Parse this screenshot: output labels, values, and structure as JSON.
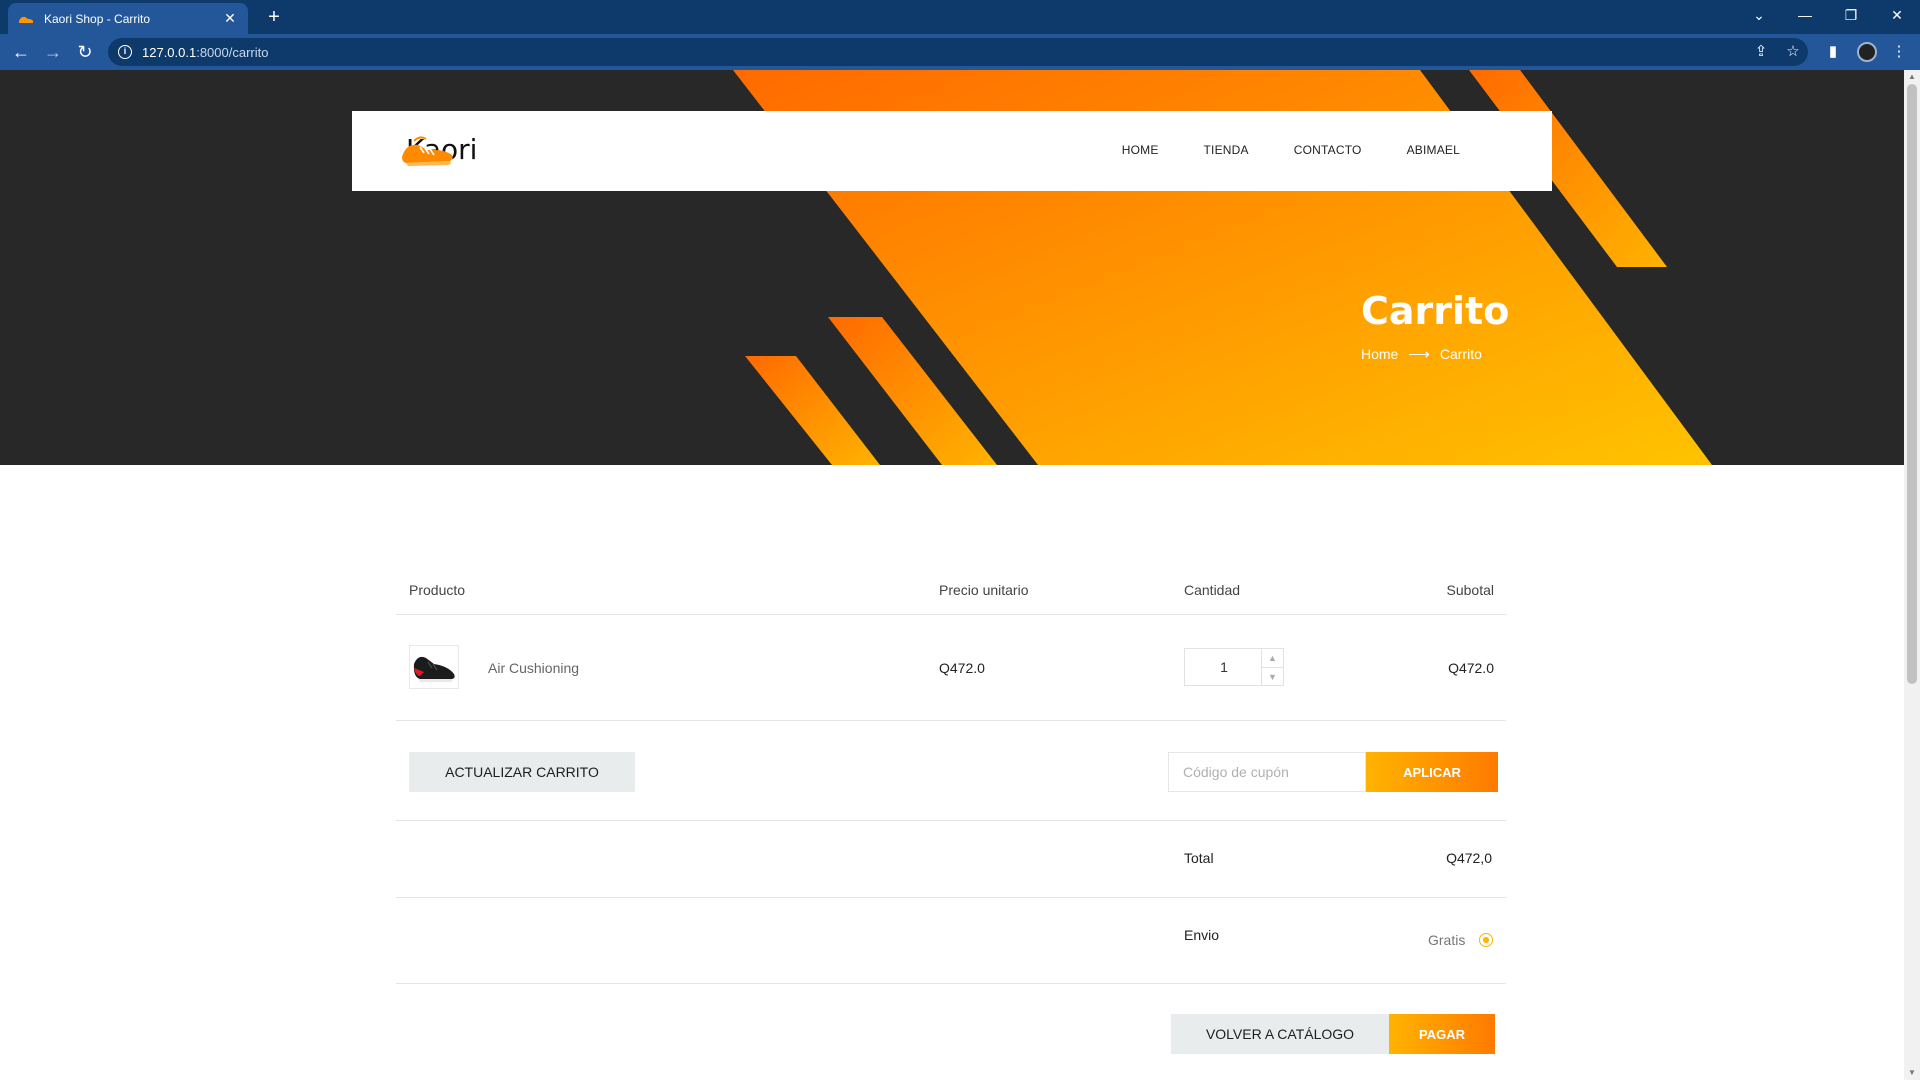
{
  "browser": {
    "tab_title": "Kaori Shop - Carrito",
    "tab_close": "✕",
    "new_tab": "+",
    "url_host": "127.0.0.1",
    "url_path": ":8000/carrito"
  },
  "header": {
    "logo_text": "Kaori",
    "nav": [
      "HOME",
      "TIENDA",
      "CONTACTO",
      "ABIMAEL"
    ]
  },
  "hero": {
    "title": "Carrito",
    "breadcrumb": [
      "Home",
      "Carrito"
    ]
  },
  "cart": {
    "columns": {
      "product": "Producto",
      "unit_price": "Precio unitario",
      "quantity": "Cantidad",
      "subtotal": "Subotal"
    },
    "items": [
      {
        "name": "Air Cushioning",
        "unit_price": "Q472.0",
        "quantity": "1",
        "subtotal": "Q472.0"
      }
    ],
    "update_button": "ACTUALIZAR CARRITO",
    "coupon_placeholder": "Código de cupón",
    "apply_button": "APLICAR",
    "total_label": "Total",
    "total_value": "Q472,0",
    "shipping_label": "Envio",
    "shipping_option": "Gratis",
    "back_button": "VOLVER A CATÁLOGO",
    "pay_button": "PAGAR"
  },
  "colors": {
    "accent_start": "#ffb300",
    "accent_end": "#ff7a00",
    "hero_bg": "#282828",
    "chrome": "#23579a"
  }
}
